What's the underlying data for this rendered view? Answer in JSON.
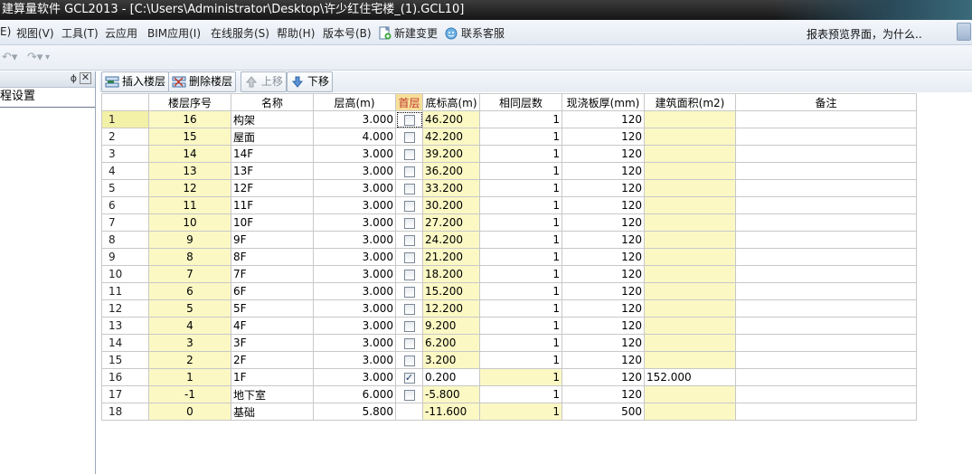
{
  "window": {
    "title": "建算量软件 GCL2013 - [C:\\Users\\Administrator\\Desktop\\许少红住宅楼_(1).GCL10]"
  },
  "menu": {
    "items": [
      "E)",
      "视图(V)",
      "工具(T)",
      "云应用",
      "BIM应用(I)",
      "在线服务(S)",
      "帮助(H)",
      "版本号(B)",
      "新建变更",
      "联系客服"
    ],
    "report_note": "报表预览界面，为什么.."
  },
  "left_panel": {
    "pin": "ϕ",
    "close": "✕",
    "title": "程设置"
  },
  "grid_toolbar": {
    "insert": "插入楼层",
    "delete": "删除楼层",
    "up": "上移",
    "down": "下移"
  },
  "colors": {
    "yellow_cell": "#fbf8c4",
    "header_highlight": "#f7df9a"
  },
  "table": {
    "headers": [
      "楼层序号",
      "名称",
      "层高(m)",
      "首层",
      "底标高(m)",
      "相同层数",
      "现浇板厚(mm)",
      "建筑面积(m2)",
      "备注"
    ],
    "rows": [
      {
        "n": "1",
        "seq": "16",
        "name": "构架",
        "h": "3.000",
        "first": false,
        "base": "46.200",
        "same": "1",
        "slab": "120",
        "area": ""
      },
      {
        "n": "2",
        "seq": "15",
        "name": "屋面",
        "h": "4.000",
        "first": false,
        "base": "42.200",
        "same": "1",
        "slab": "120",
        "area": ""
      },
      {
        "n": "3",
        "seq": "14",
        "name": "14F",
        "h": "3.000",
        "first": false,
        "base": "39.200",
        "same": "1",
        "slab": "120",
        "area": ""
      },
      {
        "n": "4",
        "seq": "13",
        "name": "13F",
        "h": "3.000",
        "first": false,
        "base": "36.200",
        "same": "1",
        "slab": "120",
        "area": ""
      },
      {
        "n": "5",
        "seq": "12",
        "name": "12F",
        "h": "3.000",
        "first": false,
        "base": "33.200",
        "same": "1",
        "slab": "120",
        "area": ""
      },
      {
        "n": "6",
        "seq": "11",
        "name": "11F",
        "h": "3.000",
        "first": false,
        "base": "30.200",
        "same": "1",
        "slab": "120",
        "area": ""
      },
      {
        "n": "7",
        "seq": "10",
        "name": "10F",
        "h": "3.000",
        "first": false,
        "base": "27.200",
        "same": "1",
        "slab": "120",
        "area": ""
      },
      {
        "n": "8",
        "seq": "9",
        "name": "9F",
        "h": "3.000",
        "first": false,
        "base": "24.200",
        "same": "1",
        "slab": "120",
        "area": ""
      },
      {
        "n": "9",
        "seq": "8",
        "name": "8F",
        "h": "3.000",
        "first": false,
        "base": "21.200",
        "same": "1",
        "slab": "120",
        "area": ""
      },
      {
        "n": "10",
        "seq": "7",
        "name": "7F",
        "h": "3.000",
        "first": false,
        "base": "18.200",
        "same": "1",
        "slab": "120",
        "area": ""
      },
      {
        "n": "11",
        "seq": "6",
        "name": "6F",
        "h": "3.000",
        "first": false,
        "base": "15.200",
        "same": "1",
        "slab": "120",
        "area": ""
      },
      {
        "n": "12",
        "seq": "5",
        "name": "5F",
        "h": "3.000",
        "first": false,
        "base": "12.200",
        "same": "1",
        "slab": "120",
        "area": ""
      },
      {
        "n": "13",
        "seq": "4",
        "name": "4F",
        "h": "3.000",
        "first": false,
        "base": "9.200",
        "same": "1",
        "slab": "120",
        "area": ""
      },
      {
        "n": "14",
        "seq": "3",
        "name": "3F",
        "h": "3.000",
        "first": false,
        "base": "6.200",
        "same": "1",
        "slab": "120",
        "area": ""
      },
      {
        "n": "15",
        "seq": "2",
        "name": "2F",
        "h": "3.000",
        "first": false,
        "base": "3.200",
        "same": "1",
        "slab": "120",
        "area": ""
      },
      {
        "n": "16",
        "seq": "1",
        "name": "1F",
        "h": "3.000",
        "first": true,
        "base": "0.200",
        "same": "1",
        "slab": "120",
        "area": "152.000"
      },
      {
        "n": "17",
        "seq": "-1",
        "name": "地下室",
        "h": "6.000",
        "first": false,
        "base": "-5.800",
        "same": "1",
        "slab": "120",
        "area": ""
      },
      {
        "n": "18",
        "seq": "0",
        "name": "基础",
        "h": "5.800",
        "first": null,
        "base": "-11.600",
        "same": "1",
        "slab": "500",
        "area": ""
      }
    ]
  }
}
